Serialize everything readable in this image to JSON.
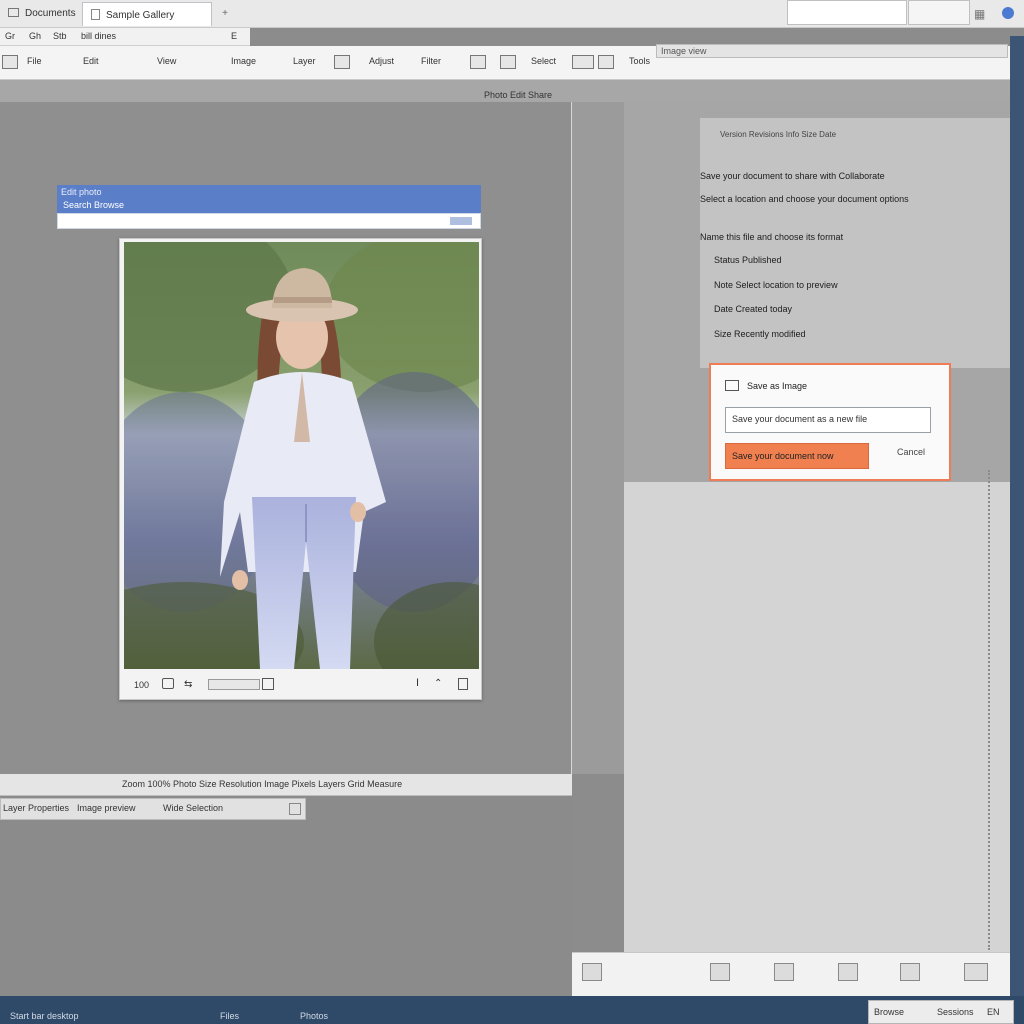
{
  "tabs": {
    "docs_label": "Documents",
    "active_label": "Sample  Gallery",
    "new_tab_label": "+"
  },
  "toolbar1": {
    "items": [
      "Gr",
      "Gh",
      "Stb",
      "bill dines",
      "E"
    ]
  },
  "toolbar2": {
    "items": [
      "File",
      "Edit",
      "View",
      "Image",
      "Layer",
      "Adjust",
      "Filter",
      "Select",
      "Tools"
    ],
    "address": "Image view"
  },
  "canvas_header": {
    "label": "Photo  Edit  Share"
  },
  "dialog": {
    "title": "Edit photo",
    "subtitle": "Search  Browse"
  },
  "photo_card": {
    "zoom": "100",
    "footer_icons": [
      "camera-icon",
      "share-icon",
      "slider",
      "info-icon",
      "tag-icon",
      "trash-icon"
    ]
  },
  "info_pane": {
    "header": "Version  Revisions  Info  Size  Date",
    "lines": [
      "Save your document to share with Collaborate",
      "Select a location and choose your document options",
      "Name this file and choose its format",
      "Status  Published",
      "Note  Select location to preview",
      "Date  Created today",
      "Size  Recently modified"
    ]
  },
  "save_dialog": {
    "title": "Save as  Image",
    "input_value": "Save your document as a new file",
    "save_label": "Save your document now",
    "cancel_label": "Cancel"
  },
  "left_footer": {
    "status": "Zoom  100%  Photo  Size  Resolution  Image  Pixels  Layers  Grid  Measure",
    "tab1": "Layer Properties",
    "tab2": "Image preview",
    "tab3": "Wide Selection"
  },
  "taskbar": {
    "items": [
      "Start  bar  desktop",
      "Files",
      "Photos"
    ],
    "tray1": "Browse",
    "tray2": "Sessions",
    "tray3": "EN"
  }
}
